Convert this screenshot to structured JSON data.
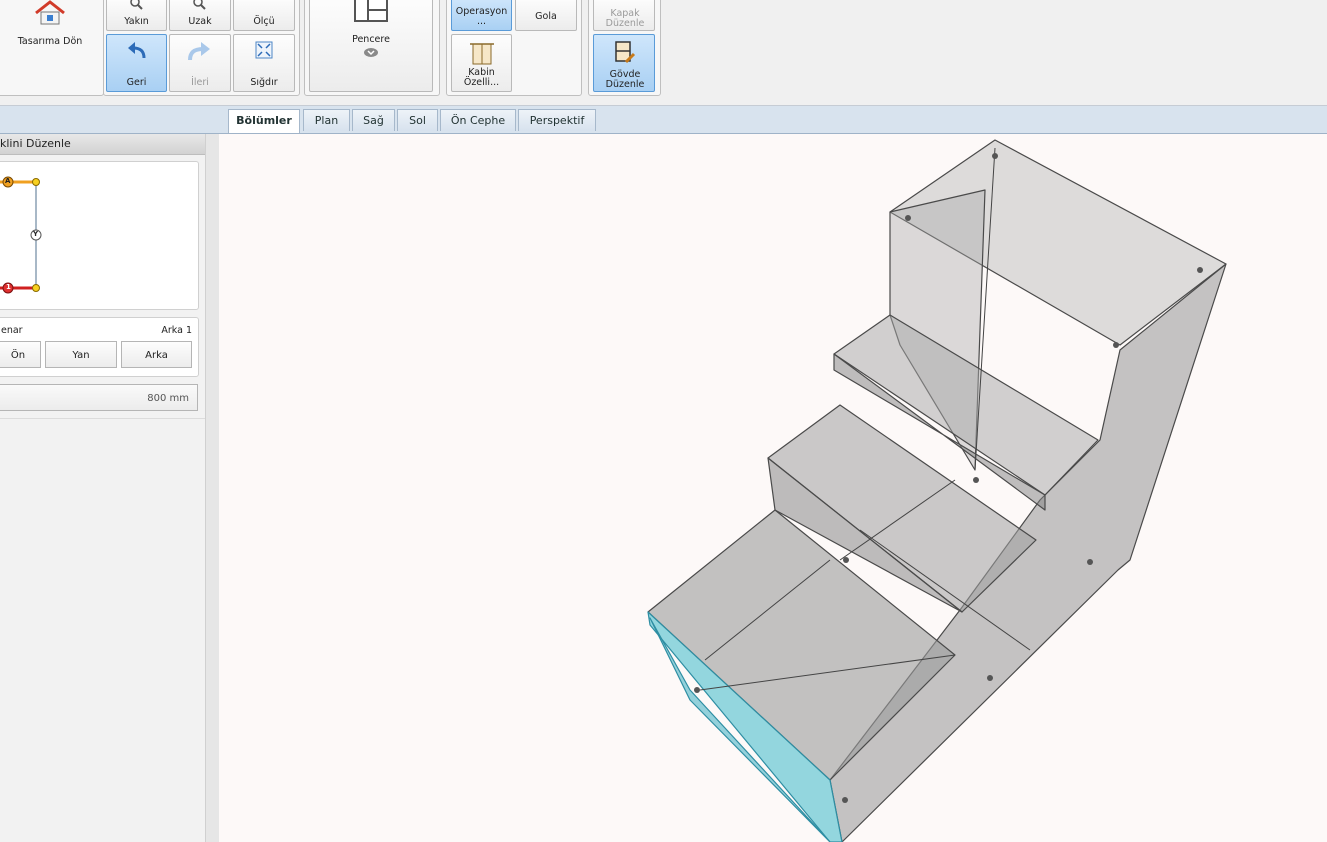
{
  "toolbar": {
    "home_label": "Tasarıma Dön",
    "zoom_in_label": "Yakın",
    "zoom_out_label": "Uzak",
    "measure_label": "Ölçü",
    "undo_label": "Geri",
    "redo_label": "İleri",
    "fit_label": "Sığdır",
    "window_label": "Pencere",
    "operation_label": "Operasyon ...",
    "gola_label": "Gola",
    "cabinet_props_label": "Kabin Özelli...",
    "door_edit_label": "Kapak Düzenle",
    "body_edit_label": "Gövde Düzenle"
  },
  "view_tabs": [
    {
      "label": "Bölümler",
      "active": true
    },
    {
      "label": "Plan",
      "active": false
    },
    {
      "label": "Sağ",
      "active": false
    },
    {
      "label": "Sol",
      "active": false
    },
    {
      "label": "Ön Cephe",
      "active": false
    },
    {
      "label": "Perspektif",
      "active": false
    }
  ],
  "left_panel": {
    "title": "klini Düzenle",
    "shape_nodes": {
      "top": "A",
      "middle": "Y",
      "bottom": "1"
    },
    "edge_label": "enar",
    "edge_value": "Arka 1",
    "edge_buttons": [
      "Ön",
      "Yan",
      "Arka"
    ],
    "dimension_value": "800 mm"
  },
  "colors": {
    "accent_active": "#a9d0f3",
    "edge_top": "#f0a020",
    "edge_bottom": "#d02020",
    "selected_face": "#6fc9d6"
  }
}
